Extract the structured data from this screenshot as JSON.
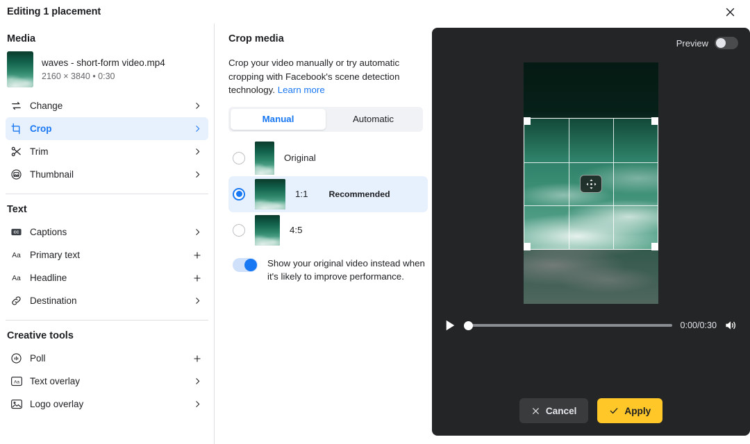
{
  "header": {
    "title": "Editing 1 placement",
    "close_icon": "close-icon"
  },
  "sidebar": {
    "sections": [
      {
        "title": "Media",
        "media": {
          "name": "waves - short-form video.mp4",
          "details": "2160 × 3840 • 0:30"
        },
        "items": [
          {
            "label": "Change",
            "icon": "swap-arrows-icon",
            "end": "chevron-right-icon",
            "active": false
          },
          {
            "label": "Crop",
            "icon": "crop-icon",
            "end": "chevron-right-icon",
            "active": true
          },
          {
            "label": "Trim",
            "icon": "scissors-icon",
            "end": "chevron-right-icon",
            "active": false
          },
          {
            "label": "Thumbnail",
            "icon": "image-circle-icon",
            "end": "chevron-right-icon",
            "active": false
          }
        ]
      },
      {
        "title": "Text",
        "items": [
          {
            "label": "Captions",
            "icon": "closed-captions-icon",
            "end": "chevron-right-icon",
            "active": false
          },
          {
            "label": "Primary text",
            "icon": "text-aa-icon",
            "end": "plus-icon",
            "active": false
          },
          {
            "label": "Headline",
            "icon": "text-aa-icon",
            "end": "plus-icon",
            "active": false
          },
          {
            "label": "Destination",
            "icon": "link-icon",
            "end": "chevron-right-icon",
            "active": false
          }
        ]
      },
      {
        "title": "Creative tools",
        "items": [
          {
            "label": "Poll",
            "icon": "poll-icon",
            "end": "plus-icon",
            "active": false
          },
          {
            "label": "Text overlay",
            "icon": "text-overlay-icon",
            "end": "chevron-right-icon",
            "active": false
          },
          {
            "label": "Logo overlay",
            "icon": "logo-overlay-icon",
            "end": "chevron-right-icon",
            "active": false
          }
        ]
      }
    ]
  },
  "crop_panel": {
    "title": "Crop media",
    "panel_toggle_icon": "panel-layout-icon",
    "description": "Crop your video manually or try automatic cropping with Facebook's scene detection technology.",
    "learn_more": "Learn more",
    "tabs": [
      {
        "label": "Manual",
        "active": true
      },
      {
        "label": "Automatic",
        "active": false
      }
    ],
    "ratios": [
      {
        "label": "Original",
        "badge": "",
        "selected": false
      },
      {
        "label": "1:1",
        "badge": "Recommended",
        "selected": true
      },
      {
        "label": "4:5",
        "badge": "",
        "selected": false
      }
    ],
    "toggle": {
      "text": "Show your original video instead when it's likely to improve performance.",
      "on": true
    }
  },
  "preview": {
    "label": "Preview",
    "toggle_on": false,
    "move_handle_icon": "move-icon",
    "player": {
      "play_icon": "play-icon",
      "progress_percent": 0,
      "time": "0:00/0:30",
      "volume_icon": "volume-icon"
    },
    "actions": {
      "cancel": "Cancel",
      "cancel_icon": "close-icon",
      "apply": "Apply",
      "apply_icon": "check-icon"
    }
  },
  "colors": {
    "accent_blue": "#1877f2",
    "apply_yellow": "#ffc727",
    "panel_dark": "#242526",
    "text_secondary": "#65676b"
  }
}
